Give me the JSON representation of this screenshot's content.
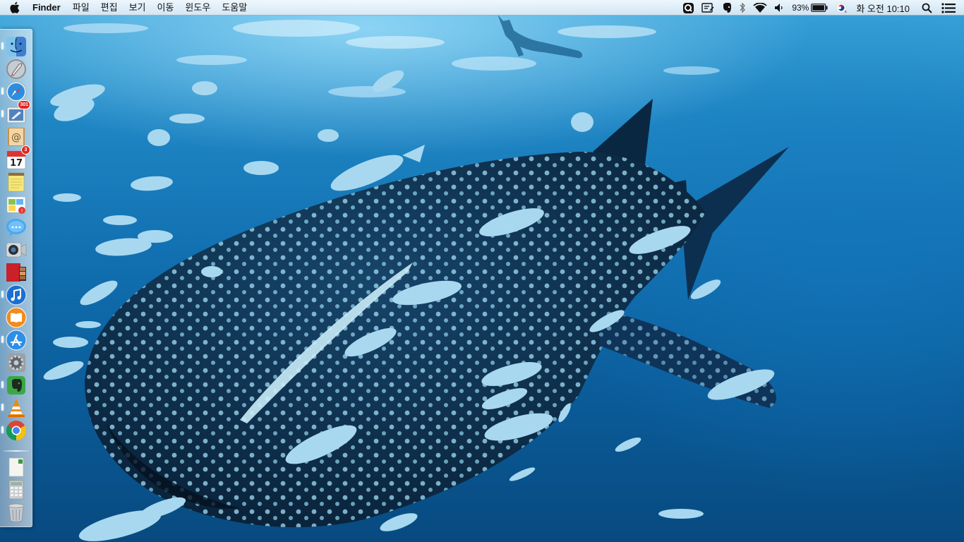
{
  "menubar": {
    "app_name": "Finder",
    "menus": [
      "파일",
      "편집",
      "보기",
      "이동",
      "윈도우",
      "도움말"
    ],
    "battery_percent": "93%",
    "clock": "화 오전 10:10",
    "status_icons": [
      "quicksilver-icon",
      "text-input-icon",
      "evernote-icon",
      "bluetooth-icon",
      "wifi-icon",
      "volume-icon",
      "battery-icon",
      "korean-flag-icon",
      "spotlight-icon",
      "notification-center-icon"
    ]
  },
  "dock": {
    "items": [
      {
        "name": "finder",
        "running": true
      },
      {
        "name": "launchpad",
        "running": false
      },
      {
        "name": "safari",
        "running": true
      },
      {
        "name": "mail",
        "running": true,
        "badge": "301"
      },
      {
        "name": "contacts",
        "running": false
      },
      {
        "name": "calendar",
        "running": false,
        "badge": "3",
        "date": "17"
      },
      {
        "name": "notes",
        "running": false
      },
      {
        "name": "reminders",
        "running": false
      },
      {
        "name": "messages",
        "running": false
      },
      {
        "name": "facetime",
        "running": false
      },
      {
        "name": "photo-booth",
        "running": false
      },
      {
        "name": "itunes",
        "running": true
      },
      {
        "name": "ibooks",
        "running": false
      },
      {
        "name": "app-store",
        "running": true
      },
      {
        "name": "system-preferences",
        "running": false
      },
      {
        "name": "evernote",
        "running": true
      },
      {
        "name": "vlc",
        "running": true
      },
      {
        "name": "chrome",
        "running": true
      },
      {
        "name": "document",
        "running": false
      },
      {
        "name": "calculator",
        "running": false
      },
      {
        "name": "trash",
        "running": false
      }
    ]
  },
  "colors": {
    "water_top": "#3aa3d9",
    "water_bottom": "#084a80",
    "shark_body": "#0e2f4e",
    "shark_spots": "#9fdaf2",
    "fish": "#a8d8ef"
  }
}
